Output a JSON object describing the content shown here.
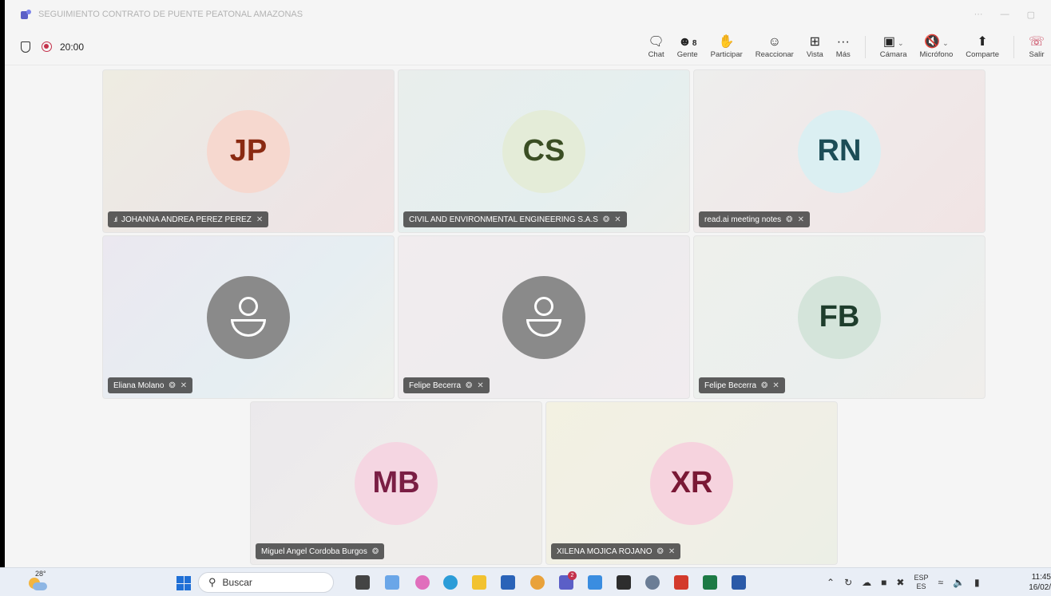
{
  "window": {
    "title": "SEGUIMIENTO CONTRATO DE PUENTE PEATONAL AMAZONAS",
    "minimize_glyph": "···",
    "restore_glyph": "—",
    "close_glyph": "▢"
  },
  "meeting": {
    "timer": "20:00",
    "tools": {
      "chat": "Chat",
      "people": "Gente",
      "people_count": "8",
      "raise": "Participar",
      "react": "Reaccionar",
      "view": "Vista",
      "more": "Más",
      "camera": "Cámara",
      "mic": "Micrófono",
      "share": "Comparte",
      "leave": "Salir"
    }
  },
  "participants": [
    {
      "initials": "JP",
      "name": "JOHANNA ANDREA PEREZ PEREZ",
      "avatar_bg": "#f6d8cf",
      "avatar_fg": "#8a2a12",
      "tile_bg": "linear-gradient(135deg,#eeece2,#ece6e6 60%,#f0e3e3)"
    },
    {
      "initials": "CS",
      "name": "CIVIL AND ENVIRONMENTAL ENGINEERING S.A.S",
      "avatar_bg": "#e4ecd8",
      "avatar_fg": "#3a4e23",
      "tile_bg": "linear-gradient(135deg,#e9eeec,#e5efef 60%,#eceeea)"
    },
    {
      "initials": "RN",
      "name": "read.ai meeting notes",
      "avatar_bg": "#dbeff2",
      "avatar_fg": "#1c4d57",
      "tile_bg": "linear-gradient(135deg,#eeeeed,#f0e8e8 60%,#f1e4e4)"
    },
    {
      "initials": "",
      "name": "Eliana Molano",
      "avatar_bg": "#8a8a8a",
      "avatar_fg": "#ffffff",
      "tile_bg": "linear-gradient(135deg,#ebe8f0,#e6eef2 60%,#eef0ec)"
    },
    {
      "initials": "",
      "name": "Felipe Becerra",
      "avatar_bg": "#8a8a8a",
      "avatar_fg": "#ffffff",
      "tile_bg": "linear-gradient(135deg,#f1ecee,#eeecee 60%,#f1ecef)"
    },
    {
      "initials": "FB",
      "name": "Felipe Becerra",
      "avatar_bg": "#d4e4da",
      "avatar_fg": "#1e3d2c",
      "tile_bg": "linear-gradient(135deg,#eef0ec,#ebefee 60%,#f0eeeb)"
    },
    {
      "initials": "MB",
      "name": "Miguel Angel Cordoba Burgos",
      "avatar_bg": "#f5d6e2",
      "avatar_fg": "#7a1e44",
      "tile_bg": "linear-gradient(135deg,#ebe9ec,#efedeb 60%,#eeedea)"
    },
    {
      "initials": "XR",
      "name": "XILENA MOJICA ROJANO",
      "avatar_bg": "#f6d3de",
      "avatar_fg": "#7a1835",
      "tile_bg": "linear-gradient(135deg,#f3f1e2,#f0efe6 60%,#ecefe6)"
    }
  ],
  "taskbar": {
    "temperature": "28°",
    "search_label": "Buscar",
    "teams_badge": "2",
    "lang_top": "ESP",
    "lang_bottom": "ES",
    "time": "11:45",
    "date": "16/02/"
  }
}
